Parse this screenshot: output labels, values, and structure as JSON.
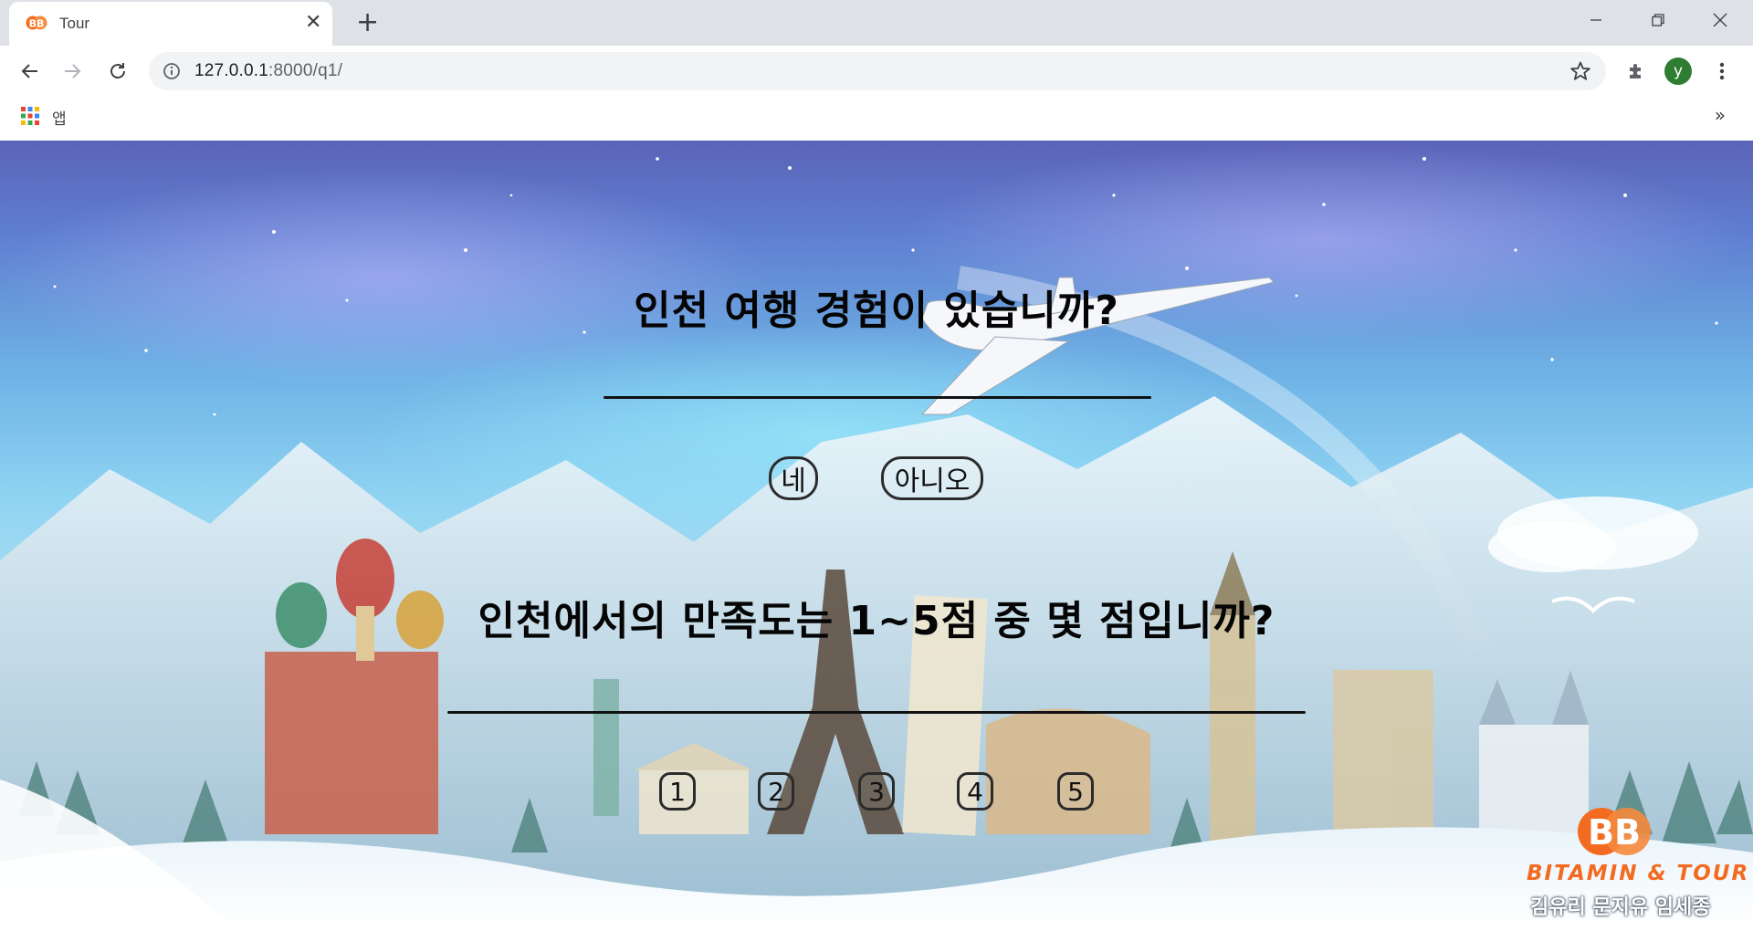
{
  "browser": {
    "tab_title": "Tour",
    "url_host": "127.0.0.1",
    "url_rest": ":8000/q1/",
    "profile_initial": "y",
    "bookmarks": {
      "apps_label": "앱",
      "overflow": "»"
    }
  },
  "colors": {
    "accent_orange": "#f26b21",
    "profile_green": "#2e7d32"
  },
  "icons": [
    "back-arrow-icon",
    "forward-arrow-icon",
    "reload-icon",
    "info-icon",
    "star-icon",
    "extensions-icon",
    "kebab-menu-icon",
    "apps-grid-icon",
    "close-icon",
    "plus-icon",
    "minimize-icon",
    "restore-icon"
  ],
  "question1": {
    "text": "인천 여행 경험이 있습니까?",
    "answers": [
      "네",
      "아니오"
    ]
  },
  "question2": {
    "text": "인천에서의 만족도는 1~5점 중 몇 점입니까?",
    "scores": [
      "1",
      "2",
      "3",
      "4",
      "5"
    ]
  },
  "logo": {
    "brand": "BITAMIN & TOUR",
    "authors": "김유리 문지유 임세종"
  }
}
